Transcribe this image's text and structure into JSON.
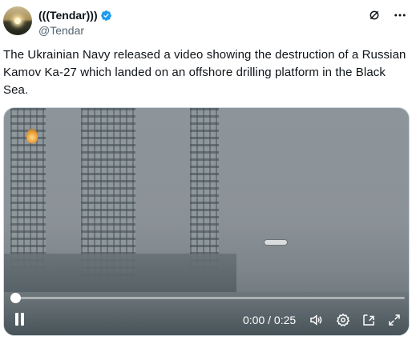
{
  "author": {
    "display_name": "(((Tendar)))",
    "handle": "@Tendar",
    "verified": true
  },
  "header_icons": [
    "grok-icon",
    "more-icon"
  ],
  "tweet": {
    "text": "The Ukrainian Navy released a video showing the destruction of a Russian Kamov Ka-27 which landed on an offshore drilling platform in the Black Sea."
  },
  "video": {
    "time_display": "0:00 / 0:25",
    "progress": 0,
    "controls": [
      "pause-icon",
      "volume-icon",
      "settings-icon",
      "pip-icon",
      "fullscreen-icon"
    ]
  },
  "colors": {
    "verified": "#1d9bf0",
    "text": "#0f1419",
    "secondary": "#536471"
  }
}
